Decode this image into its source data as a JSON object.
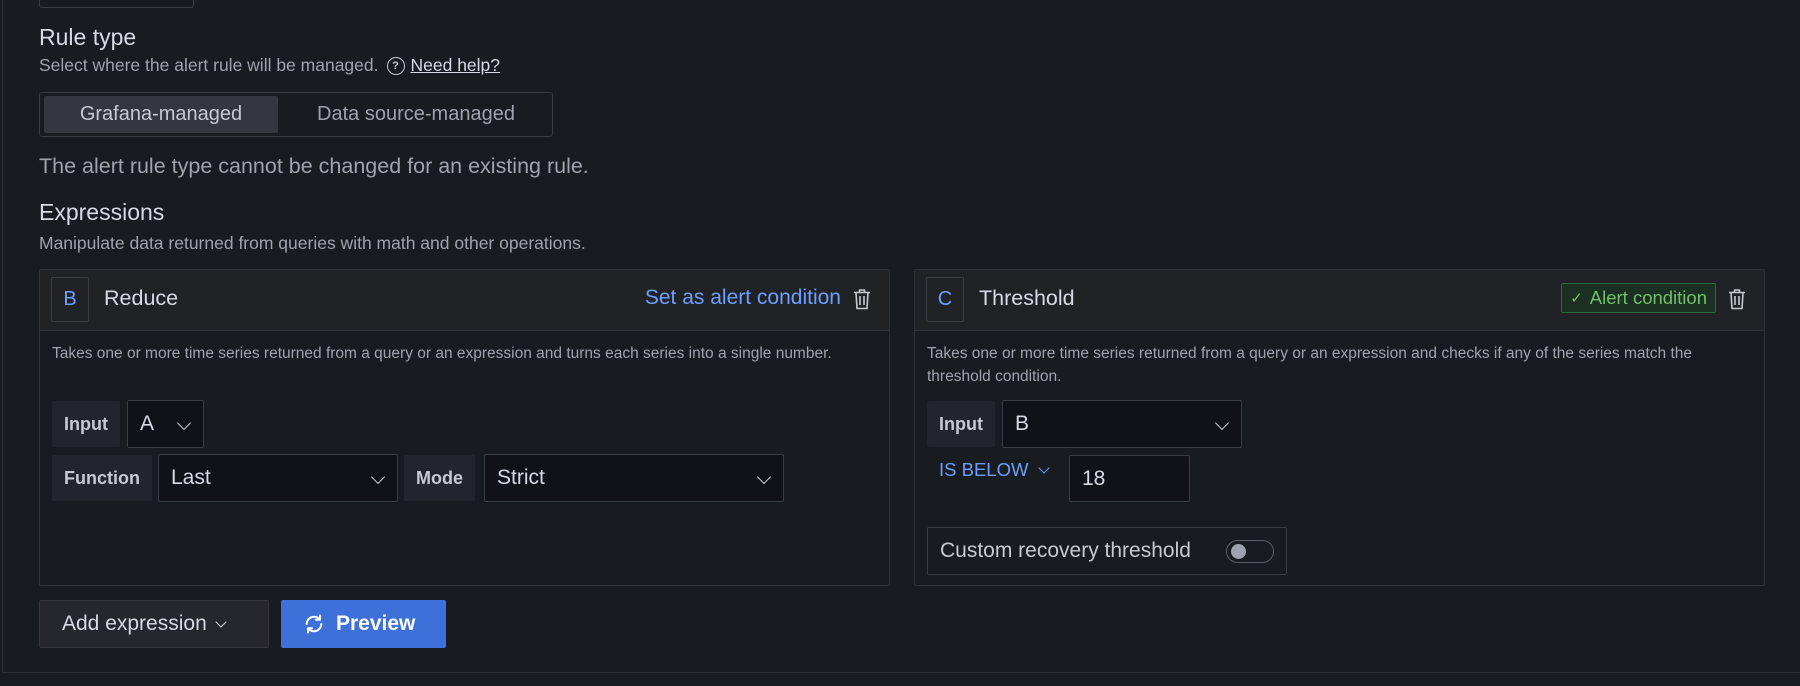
{
  "rule_type": {
    "title": "Rule type",
    "description": "Select where the alert rule will be managed.",
    "help_link": "Need help?",
    "options": [
      "Grafana-managed",
      "Data source-managed"
    ],
    "selected": "Grafana-managed",
    "note": "The alert rule type cannot be changed for an existing rule."
  },
  "expressions": {
    "title": "Expressions",
    "description": "Manipulate data returned from queries with math and other operations.",
    "cards": [
      {
        "ref_id": "B",
        "type": "Reduce",
        "action": "Set as alert condition",
        "description": "Takes one or more time series returned from a query or an expression and turns each series into a single number.",
        "input_label": "Input",
        "input_value": "A",
        "function_label": "Function",
        "function_value": "Last",
        "mode_label": "Mode",
        "mode_value": "Strict"
      },
      {
        "ref_id": "C",
        "type": "Threshold",
        "badge": "Alert condition",
        "description": "Takes one or more time series returned from a query or an expression and checks if any of the series match the threshold condition.",
        "input_label": "Input",
        "input_value": "B",
        "condition": "IS BELOW",
        "threshold_value": "18",
        "recovery_label": "Custom recovery threshold",
        "recovery_enabled": false
      }
    ]
  },
  "actions": {
    "add_expression": "Add expression",
    "preview": "Preview"
  },
  "colors": {
    "background": "#181b1f",
    "accent_blue": "#6e9fff",
    "primary_button": "#3d71d9",
    "success_green": "#73bf69"
  },
  "icons": [
    "help-circle-icon",
    "trash-icon",
    "check-icon",
    "chevron-down-icon",
    "sync-icon"
  ]
}
